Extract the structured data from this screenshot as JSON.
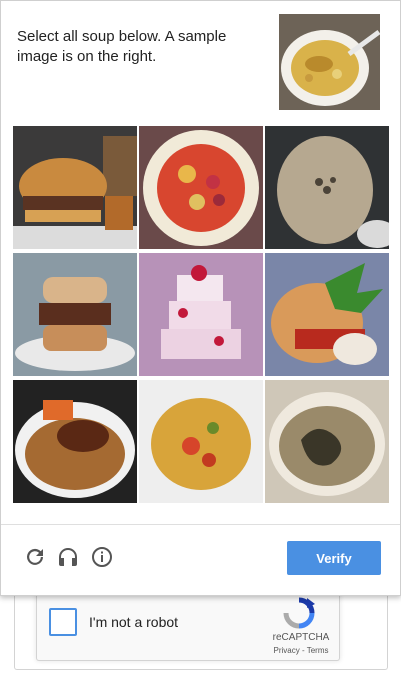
{
  "challenge": {
    "prompt": "Select all soup below. A sample image is on the right.",
    "sample_image": "soup-bowl",
    "tiles": [
      {
        "image": "burger-with-fries"
      },
      {
        "image": "tomato-soup-plate"
      },
      {
        "image": "stone-rocks"
      },
      {
        "image": "stacked-sandwich"
      },
      {
        "image": "wedding-cake"
      },
      {
        "image": "burger-with-greens"
      },
      {
        "image": "noodles-with-meat"
      },
      {
        "image": "pasta-dish"
      },
      {
        "image": "soup-in-bowl"
      }
    ],
    "footer": {
      "reload_icon": "reload-icon",
      "audio_icon": "headphones-icon",
      "info_icon": "info-icon",
      "verify_label": "Verify"
    },
    "colors": {
      "accent": "#4a90e2",
      "border": "#cfcfcf"
    }
  },
  "anchor": {
    "label": "I'm not a robot",
    "brand": "reCAPTCHA",
    "links": "Privacy - Terms"
  }
}
